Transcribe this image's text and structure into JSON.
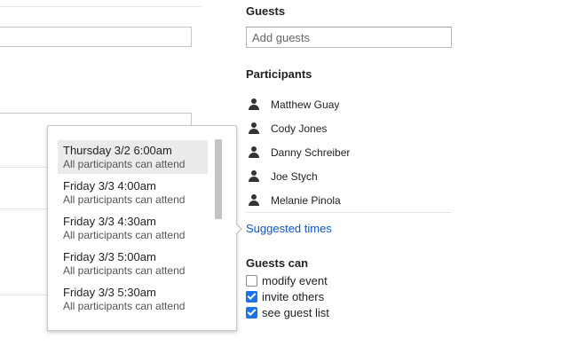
{
  "guests": {
    "title": "Guests",
    "add_placeholder": "Add guests"
  },
  "participants": {
    "title": "Participants",
    "items": [
      {
        "name": "Matthew Guay"
      },
      {
        "name": "Cody Jones"
      },
      {
        "name": "Danny Schreiber"
      },
      {
        "name": "Joe Stych"
      },
      {
        "name": "Melanie Pinola"
      }
    ]
  },
  "suggested_times_link": "Suggested times",
  "guests_can": {
    "title": "Guests can",
    "options": [
      {
        "label": "modify event",
        "checked": false
      },
      {
        "label": "invite others",
        "checked": true
      },
      {
        "label": "see guest list",
        "checked": true
      }
    ]
  },
  "suggested_popup": {
    "slots": [
      {
        "time": "Thursday 3/2 6:00am",
        "note": "All participants can attend",
        "selected": true
      },
      {
        "time": "Friday 3/3 4:00am",
        "note": "All participants can attend",
        "selected": false
      },
      {
        "time": "Friday 3/3 4:30am",
        "note": "All participants can attend",
        "selected": false
      },
      {
        "time": "Friday 3/3 5:00am",
        "note": "All participants can attend",
        "selected": false
      },
      {
        "time": "Friday 3/3 5:30am",
        "note": "All participants can attend",
        "selected": false
      }
    ]
  },
  "colors": {
    "link": "#1155cc",
    "checkbox_checked": "#1a73e8",
    "selected_slot_bg": "#ebebeb"
  }
}
